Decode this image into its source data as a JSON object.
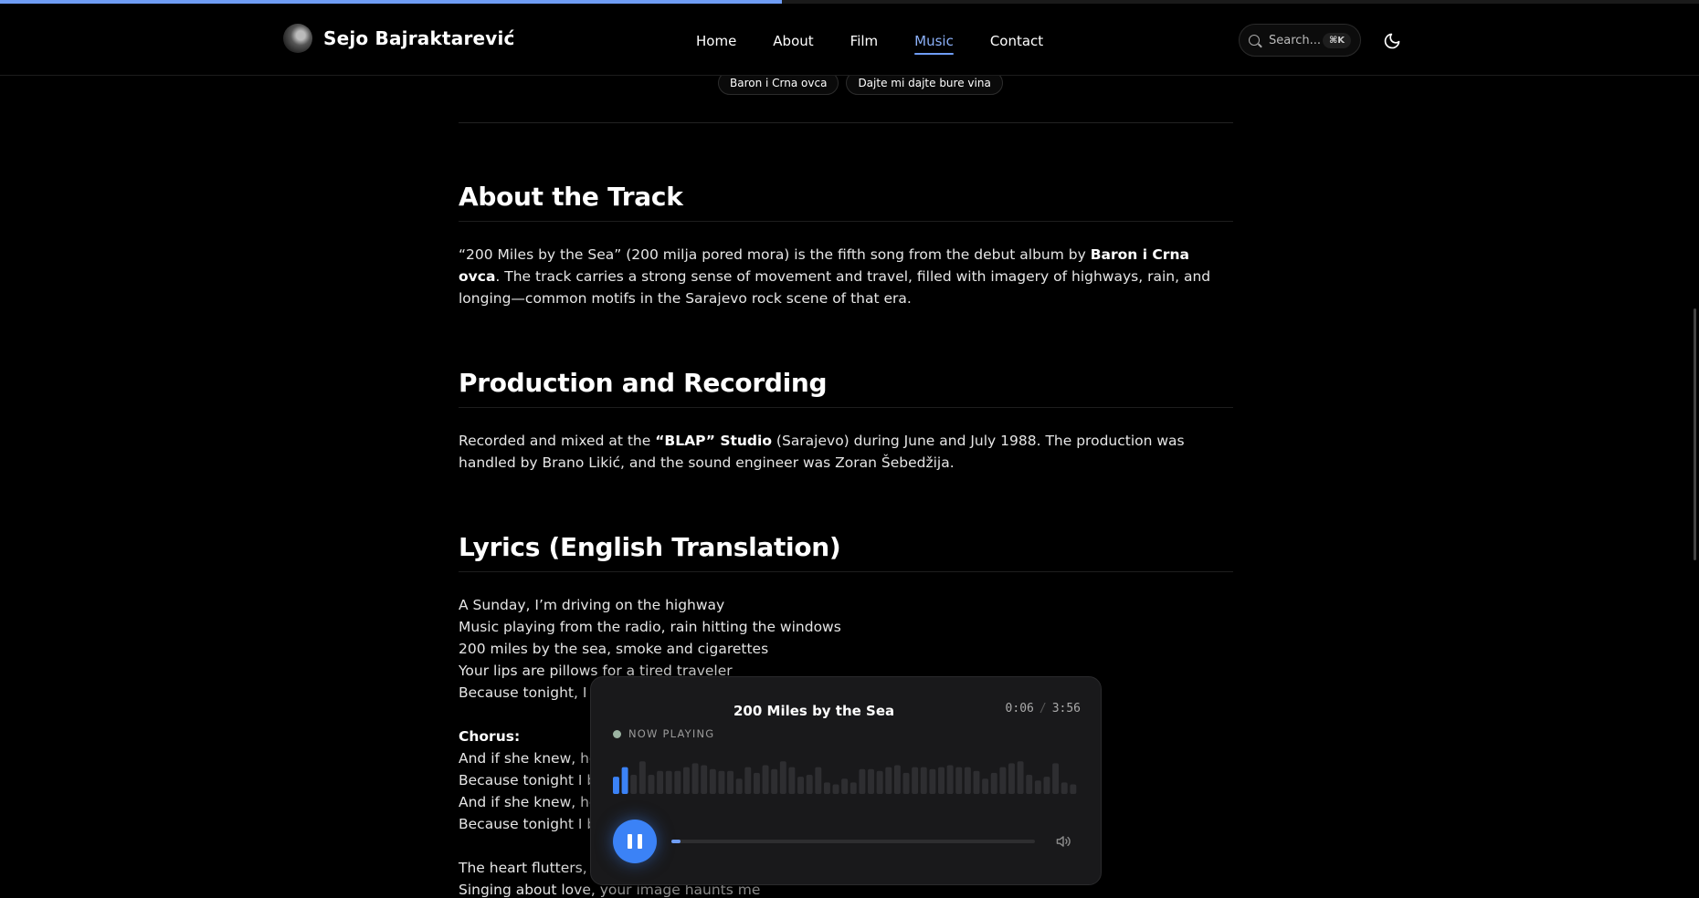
{
  "header": {
    "brand_name": "Sejo Bajraktarević",
    "nav": [
      {
        "label": "Home",
        "active": false
      },
      {
        "label": "About",
        "active": false
      },
      {
        "label": "Film",
        "active": false
      },
      {
        "label": "Music",
        "active": true
      },
      {
        "label": "Contact",
        "active": false
      }
    ],
    "search_placeholder": "Search...",
    "search_shortcut": "⌘K"
  },
  "reading_progress": 0.46,
  "tags": [
    "Baron i Crna ovca",
    "Dajte mi dajte bure vina"
  ],
  "sections": {
    "about": {
      "title": "About the Track",
      "p1": "“200 Miles by the Sea” (200 milja pored mora) is the fifth song from the debut album by ",
      "p1_bold": "Baron i Crna ovca",
      "p1_end": ". The track carries a strong sense of movement and travel, filled with imagery of highways, rain, and longing—common motifs in the Sarajevo rock scene of that era."
    },
    "production": {
      "title": "Production and Recording",
      "p1": "Recorded and mixed at the ",
      "p1_bold": "“BLAP” Studio",
      "p1_end": " (Sarajevo) during June and July 1988. The production was handled by Brano Likić, and the sound engineer was Zoran Šebedžija."
    },
    "lyrics": {
      "title": "Lyrics (English Translation)",
      "verse1": [
        "A Sunday, I’m driving on the highway",
        "Music playing from the radio, rain hitting the windows",
        "200 miles by the sea, smoke and cigarettes",
        "Your lips are pillows for a tired traveler",
        "Because tonight, I wa"
      ],
      "chorus_label": "Chorus:",
      "chorus": [
        "And if she knew, her",
        "Because tonight I bri",
        "And if she knew, her",
        "Because tonight I bri"
      ],
      "verse2": [
        "The heart flutters, my",
        "Singing about love, your image haunts me"
      ]
    }
  },
  "player": {
    "track_title": "200 Miles by the Sea",
    "current_time": "0:06",
    "separator": "/",
    "duration": "3:56",
    "status_label": "NOW PLAYING",
    "progress": 0.025,
    "played_bars": 2,
    "waveform": [
      0.45,
      0.7,
      0.5,
      0.85,
      0.5,
      0.6,
      0.6,
      0.6,
      0.7,
      0.8,
      0.75,
      0.65,
      0.6,
      0.6,
      0.4,
      0.7,
      0.55,
      0.75,
      0.65,
      0.85,
      0.7,
      0.45,
      0.5,
      0.7,
      0.3,
      0.25,
      0.4,
      0.3,
      0.65,
      0.65,
      0.6,
      0.7,
      0.75,
      0.55,
      0.7,
      0.7,
      0.65,
      0.7,
      0.75,
      0.7,
      0.7,
      0.6,
      0.4,
      0.55,
      0.7,
      0.8,
      0.85,
      0.5,
      0.35,
      0.45,
      0.8,
      0.3,
      0.25
    ],
    "colors": {
      "played": "#3b82f6",
      "unplayed": "#2e2e31",
      "accent": "#6f9df5"
    }
  }
}
